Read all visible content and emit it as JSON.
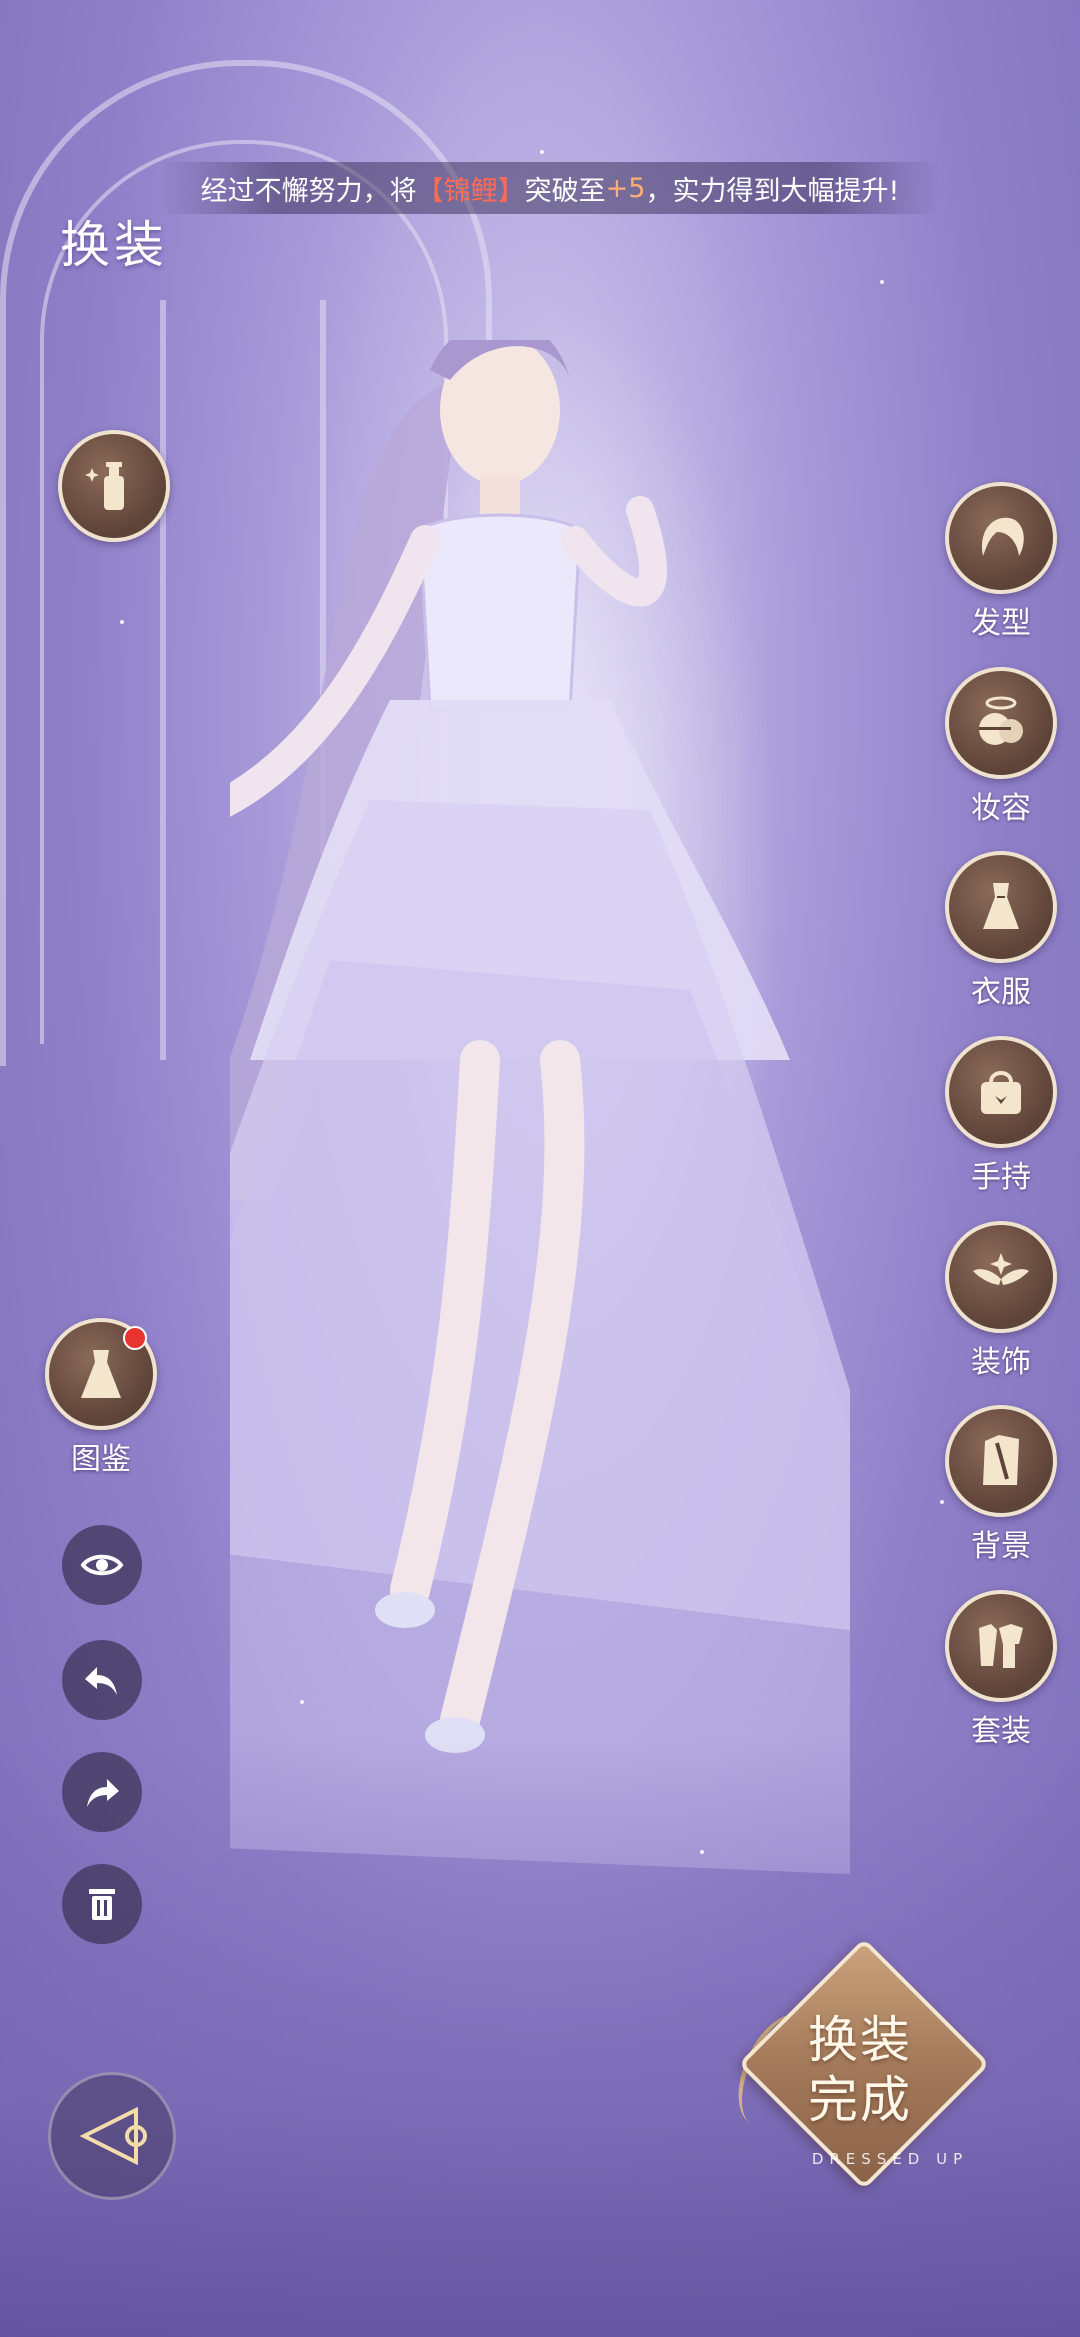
{
  "banner": {
    "prefix": "经过不懈努力，将",
    "item": "【锦鲤】",
    "middle": "突破至",
    "level": "+5",
    "suffix": "，实力得到大幅提升!"
  },
  "title": "换装",
  "categories": [
    {
      "label": "发型",
      "icon": "hair-icon"
    },
    {
      "label": "妆容",
      "icon": "makeup-icon"
    },
    {
      "label": "衣服",
      "icon": "dress-icon"
    },
    {
      "label": "手持",
      "icon": "handbag-icon"
    },
    {
      "label": "装饰",
      "icon": "wings-icon"
    },
    {
      "label": "背景",
      "icon": "background-icon"
    },
    {
      "label": "套装",
      "icon": "outfit-set-icon"
    }
  ],
  "left_panel": {
    "cosmetic_icon": "bottle-icon",
    "catalog_label": "图鉴",
    "catalog_icon": "dress-catalog-icon",
    "tools": [
      "eye-icon",
      "undo-icon",
      "redo-icon",
      "trash-icon"
    ],
    "nav_icon": "triangle-nav-icon"
  },
  "finish": {
    "label_line1": "换装",
    "label_line2": "完成",
    "sub": "DRESSED UP"
  },
  "colors": {
    "button_brown": "#5e4338",
    "button_border": "#efe3d0",
    "highlight_red": "#ff6a55",
    "highlight_orange": "#ffb070",
    "badge_red": "#e8332f"
  }
}
